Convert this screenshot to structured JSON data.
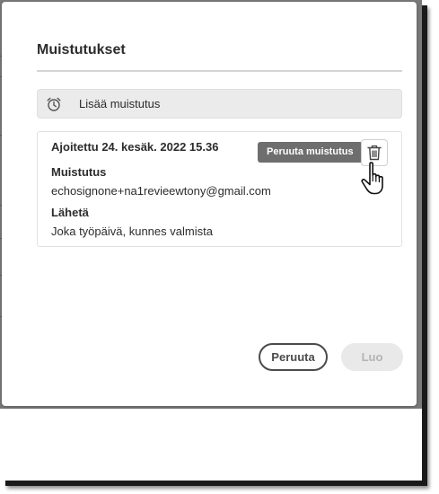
{
  "dialog": {
    "title": "Muistutukset",
    "add_reminder_label": "Lisää muistutus"
  },
  "reminder": {
    "scheduled": "Ajoitettu 24. kesäk. 2022 15.36",
    "reminder_label": "Muistutus",
    "recipient": "echosignone+na1revieewtony@gmail.com",
    "send_label": "Lähetä",
    "frequency": "Joka työpäivä, kunnes valmista"
  },
  "tooltip": {
    "text": "Peruuta muistutus"
  },
  "footer": {
    "cancel_label": "Peruuta",
    "create_label": "Luo"
  },
  "icons": {
    "add": "alarm-clock-icon",
    "delete": "trash-icon",
    "cursor": "hand-pointer-icon"
  },
  "colors": {
    "text": "#2c2c2c",
    "tooltip_bg": "#6e6e6e",
    "disabled_button_bg": "#e9e9e9",
    "disabled_button_text": "#b4b4b4",
    "backdrop": "#7a7a7a"
  }
}
